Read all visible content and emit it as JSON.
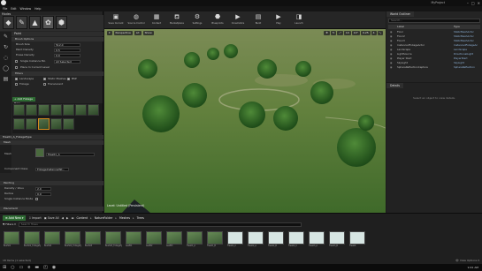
{
  "app": {
    "menu": [
      "File",
      "Edit",
      "Window",
      "Help"
    ],
    "project_name": "MyProject",
    "window_controls": [
      "–",
      "□",
      "✕"
    ]
  },
  "modes": {
    "title": "Modes",
    "buttons": [
      {
        "icon": "place-icon",
        "glyph": "◆"
      },
      {
        "icon": "paint-icon",
        "glyph": "✎"
      },
      {
        "icon": "landscape-icon",
        "glyph": "▲"
      },
      {
        "icon": "foliage-icon",
        "glyph": "✿"
      },
      {
        "icon": "geometry-icon",
        "glyph": "⬢"
      }
    ],
    "active_index": 3
  },
  "paint": {
    "header": "Paint",
    "brush_options_title": "Brush Options",
    "brush_size_label": "Brush Size",
    "brush_size": "512.0",
    "paint_density_label": "Paint Density",
    "paint_density": "0.5",
    "erase_density_label": "Erase Density",
    "erase_density": "0.0",
    "single_instance_label": "Single Instance Mo",
    "single_instance_value": "All Selected",
    "place_in_level_label": "Place In Current Level",
    "filters_title": "Filters",
    "filter_landscape": "Landscape",
    "filter_static_meshes": "Static Meshes",
    "filter_bsp": "BSP",
    "filter_foliage": "Foliage",
    "filter_translucent": "Translucent",
    "add_foliage_type": "+ Add Foliage Type",
    "detail_header": "Tree01_A_FoliageType",
    "mesh_label": "Mesh",
    "mesh_value": "Tree01_A",
    "component_label": "Component Class",
    "component_value": "FoliageInstancedSt...",
    "painting_title": "Painting",
    "density_label": "Density / 1Kuu",
    "density_value": "2.0",
    "radius_label": "Radius",
    "radius_value": "0.0",
    "single_inst_only": "Single Instance Mode",
    "placement_title": "Placement"
  },
  "toolbar": {
    "buttons": [
      {
        "icon": "save-icon",
        "glyph": "▣",
        "label": "Save Current"
      },
      {
        "icon": "source-control-icon",
        "glyph": "◍",
        "label": "Source Control"
      },
      {
        "icon": "content-icon",
        "glyph": "▦",
        "label": "Content"
      },
      {
        "icon": "marketplace-icon",
        "glyph": "⛾",
        "label": "Marketplace"
      },
      {
        "icon": "settings-icon",
        "glyph": "⚙",
        "label": "Settings"
      },
      {
        "icon": "blueprints-icon",
        "glyph": "⬣",
        "label": "Blueprints"
      },
      {
        "icon": "cinematics-icon",
        "glyph": "▶",
        "label": "Cinematics"
      },
      {
        "icon": "build-icon",
        "glyph": "▤",
        "label": "Build"
      },
      {
        "icon": "play-icon",
        "glyph": "▶",
        "label": "Play"
      },
      {
        "icon": "launch-icon",
        "glyph": "◨",
        "label": "Launch"
      }
    ]
  },
  "viewport": {
    "perspective": "Perspective",
    "lit": "Lit",
    "show": "Show",
    "snap_grid": "10",
    "snap_rot": "10°",
    "snap_scale": "0.25",
    "camera_speed": "4",
    "level_label": "Level: Untitled (Persistent)"
  },
  "outliner": {
    "title": "World Outliner",
    "search_placeholder": "Search...",
    "col_label": "Label",
    "col_type": "Type",
    "rows": [
      {
        "label": "Floor",
        "type": "StaticMeshActor"
      },
      {
        "label": "Floor2",
        "type": "StaticMeshActor"
      },
      {
        "label": "Floor3",
        "type": "StaticMeshActor"
      },
      {
        "label": "InstancedFoliageActor",
        "type": "InstancedFoliageAc"
      },
      {
        "label": "Landscape",
        "type": "Landscape"
      },
      {
        "label": "LightSource",
        "type": "DirectionalLight"
      },
      {
        "label": "Player Start",
        "type": "PlayerStart"
      },
      {
        "label": "SkyLight",
        "type": "SkyLight"
      },
      {
        "label": "SphereReflectionCapture",
        "type": "SphereReflection"
      }
    ],
    "footer": "9 actors",
    "view_options": "👁 View Options ▾"
  },
  "details": {
    "title": "Details",
    "empty_text": "Select an object to view details."
  },
  "content_browser": {
    "tab": "Content Browser",
    "add_new": "⊕ Add New ▾",
    "import": "⇩ Import",
    "save_all": "▣ Save All",
    "breadcrumbs": [
      "Content",
      "NatureFolder",
      "Meshes",
      "Trees"
    ],
    "filters": "▼ Filters ▾",
    "search_placeholder": "Search Trees",
    "assets": [
      {
        "name": "Bush01",
        "card": false
      },
      {
        "name": "Bush01_FoliageType",
        "card": false
      },
      {
        "name": "Bush02",
        "card": false
      },
      {
        "name": "Bush02_FoliageType",
        "card": false
      },
      {
        "name": "Bush03",
        "card": false
      },
      {
        "name": "Bush03_FoliageType",
        "card": false
      },
      {
        "name": "Leaf01",
        "card": false
      },
      {
        "name": "Leaf02",
        "card": false
      },
      {
        "name": "Leaf03",
        "card": false
      },
      {
        "name": "Tree01_A",
        "card": false
      },
      {
        "name": "Tree01_B",
        "card": false
      },
      {
        "name": "Tree01_C",
        "card": true
      },
      {
        "name": "Tree02_A",
        "card": true
      },
      {
        "name": "Tree02_B",
        "card": true
      },
      {
        "name": "Tree02_C",
        "card": true
      },
      {
        "name": "Tree03_A",
        "card": true
      },
      {
        "name": "Tree03_B",
        "card": true
      },
      {
        "name": "Tree04",
        "card": true
      }
    ],
    "status": "18 items (1 selected)",
    "view_options": "👁 View Options ▾"
  },
  "taskbar": {
    "icons": [
      {
        "icon": "start-icon",
        "glyph": "⊞"
      },
      {
        "icon": "search-icon",
        "glyph": "○"
      },
      {
        "icon": "task-view-icon",
        "glyph": "▭"
      },
      {
        "icon": "browser-icon",
        "glyph": "e"
      },
      {
        "icon": "folder-icon",
        "glyph": "▬"
      },
      {
        "icon": "store-icon",
        "glyph": "◰"
      },
      {
        "icon": "unreal-icon",
        "glyph": "◉"
      }
    ],
    "time": "9:41 AM"
  }
}
